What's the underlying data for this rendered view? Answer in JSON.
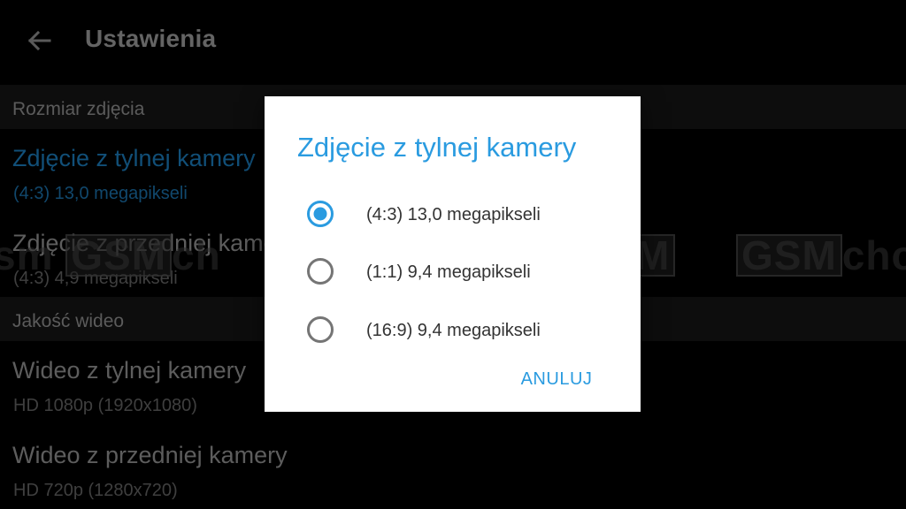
{
  "toolbar": {
    "back_icon": "arrow-left-icon",
    "title": "Ustawienia"
  },
  "sections": [
    {
      "header": "Rozmiar zdjęcia",
      "items": [
        {
          "title": "Zdjęcie z tylnej kamery",
          "summary": "(4:3) 13,0 megapikseli",
          "active": true
        },
        {
          "title": "Zdjęcie z przedniej kamery",
          "summary": "(4:3) 4,9 megapikseli",
          "active": false
        }
      ]
    },
    {
      "header": "Jakość wideo",
      "items": [
        {
          "title": "Wideo z tylnej kamery",
          "summary": "HD 1080p (1920x1080)",
          "active": false
        },
        {
          "title": "Wideo z przedniej kamery",
          "summary": "HD 720p (1280x720)",
          "active": false
        }
      ]
    }
  ],
  "watermark": {
    "left_text": "sm",
    "left_boxed": "GSM",
    "left_tail": "ch",
    "mid_boxed": "M",
    "right_boxed": "GSM",
    "right_tail": "cho"
  },
  "dialog": {
    "title": "Zdjęcie z tylnej kamery",
    "options": [
      {
        "label": "(4:3) 13,0 megapikseli",
        "selected": true
      },
      {
        "label": "(1:1) 9,4 megapikseli",
        "selected": false
      },
      {
        "label": "(16:9) 9,4 megapikseli",
        "selected": false
      }
    ],
    "cancel_label": "ANULUJ"
  },
  "colors": {
    "accent": "#2a9be0",
    "active_text": "#1b7ab8",
    "background": "#000000",
    "dialog_bg": "#ffffff",
    "radio_unselected": "#757575"
  }
}
